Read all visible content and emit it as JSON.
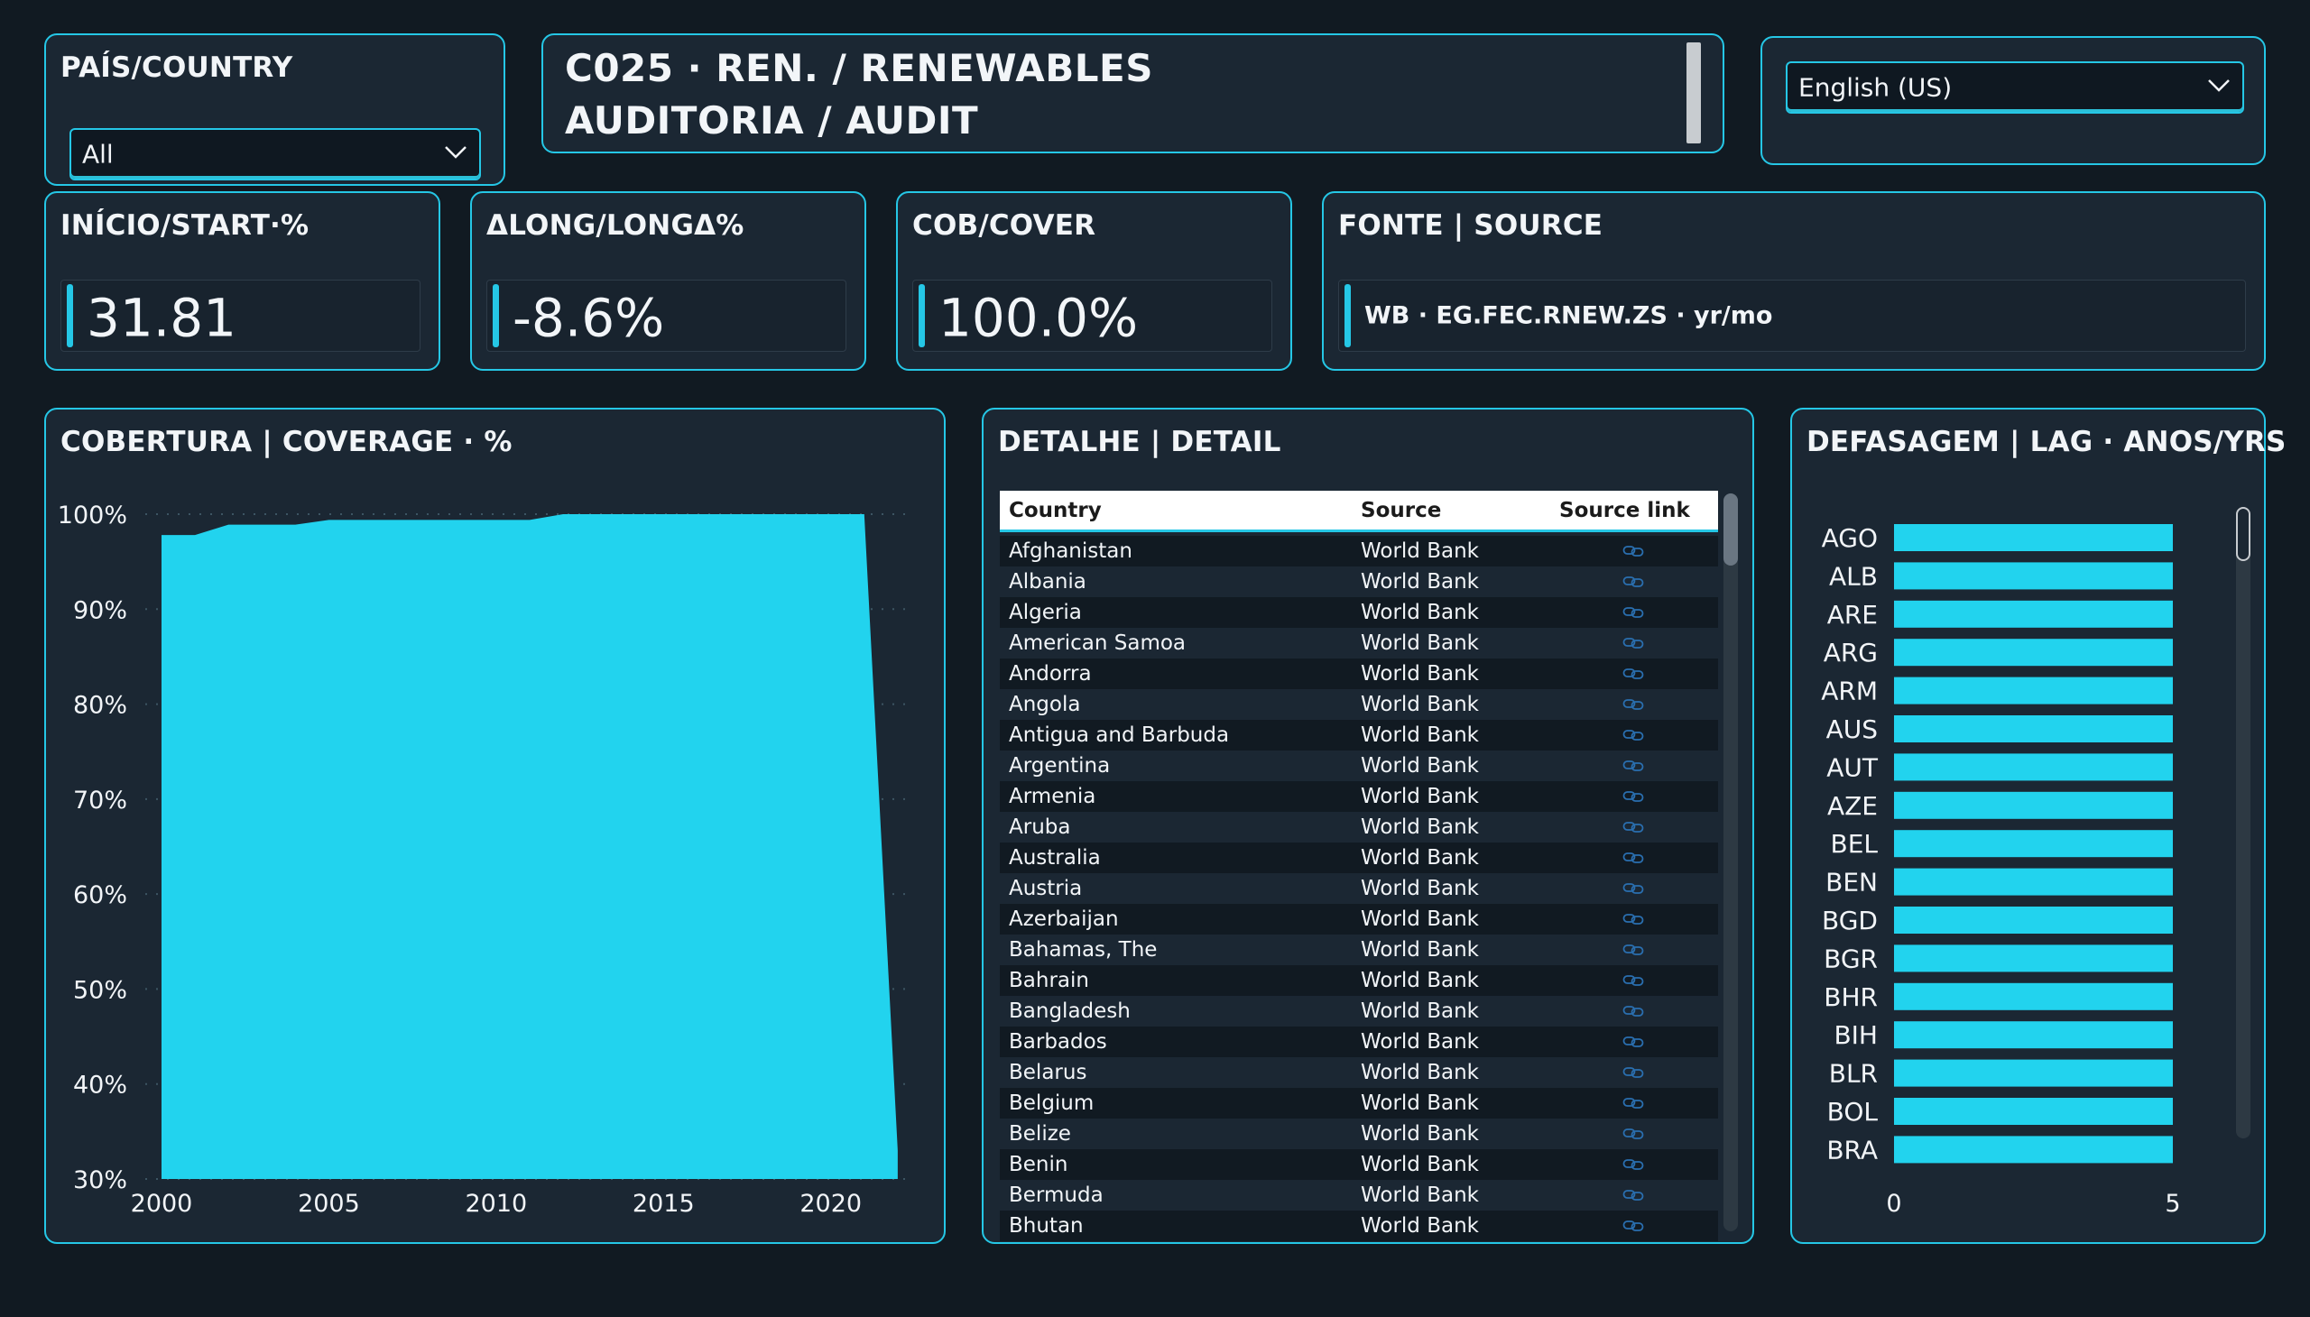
{
  "country_filter": {
    "title": "PAÍS/COUNTRY",
    "selected": "All",
    "icon": "chevron-down-icon"
  },
  "header": {
    "line1": "C025 · REN. / RENEWABLES",
    "line2": "AUDITORIA / AUDIT"
  },
  "language": {
    "selected": "English (US)",
    "icon": "chevron-down-icon"
  },
  "kpis": {
    "start": {
      "label": "INÍCIO/START·%",
      "value": "31.81"
    },
    "delta": {
      "label": "ΔLONG/LONGΔ%",
      "value": "-8.6%"
    },
    "cover": {
      "label": "COB/COVER",
      "value": "100.0%"
    },
    "source": {
      "label": "FONTE | SOURCE",
      "value": "WB · EG.FEC.RNEW.ZS · yr/mo"
    }
  },
  "colors": {
    "accent": "#25c7e6",
    "background": "#111a22",
    "card": "#1b2733"
  },
  "coverage_chart": {
    "title": "COBERTURA | COVERAGE · %",
    "y_ticks": [
      "100%",
      "90%",
      "80%",
      "70%",
      "60%",
      "50%",
      "40%",
      "30%"
    ],
    "x_ticks": [
      "2000",
      "2005",
      "2010",
      "2015",
      "2020"
    ]
  },
  "detail": {
    "title": "DETALHE | DETAIL",
    "columns": [
      "Country",
      "Source",
      "Source link"
    ],
    "link_icon": "link-icon",
    "rows": [
      [
        "Afghanistan",
        "World Bank"
      ],
      [
        "Albania",
        "World Bank"
      ],
      [
        "Algeria",
        "World Bank"
      ],
      [
        "American Samoa",
        "World Bank"
      ],
      [
        "Andorra",
        "World Bank"
      ],
      [
        "Angola",
        "World Bank"
      ],
      [
        "Antigua and Barbuda",
        "World Bank"
      ],
      [
        "Argentina",
        "World Bank"
      ],
      [
        "Armenia",
        "World Bank"
      ],
      [
        "Aruba",
        "World Bank"
      ],
      [
        "Australia",
        "World Bank"
      ],
      [
        "Austria",
        "World Bank"
      ],
      [
        "Azerbaijan",
        "World Bank"
      ],
      [
        "Bahamas, The",
        "World Bank"
      ],
      [
        "Bahrain",
        "World Bank"
      ],
      [
        "Bangladesh",
        "World Bank"
      ],
      [
        "Barbados",
        "World Bank"
      ],
      [
        "Belarus",
        "World Bank"
      ],
      [
        "Belgium",
        "World Bank"
      ],
      [
        "Belize",
        "World Bank"
      ],
      [
        "Benin",
        "World Bank"
      ],
      [
        "Bermuda",
        "World Bank"
      ],
      [
        "Bhutan",
        "World Bank"
      ]
    ]
  },
  "lag_chart": {
    "title": "DEFASAGEM | LAG · ANOS/YRS",
    "x_ticks": [
      "0",
      "5"
    ]
  },
  "chart_data": [
    {
      "type": "area",
      "title": "COBERTURA | COVERAGE · %",
      "xlabel": "",
      "ylabel": "",
      "x": [
        2000,
        2001,
        2002,
        2003,
        2004,
        2005,
        2006,
        2007,
        2008,
        2009,
        2010,
        2011,
        2012,
        2013,
        2014,
        2015,
        2016,
        2017,
        2018,
        2019,
        2020,
        2021,
        2022
      ],
      "series": [
        {
          "values": [
            97.8,
            97.8,
            98.9,
            98.9,
            98.9,
            99.4,
            99.4,
            99.4,
            99.4,
            99.4,
            99.4,
            99.4,
            100,
            100,
            100,
            100,
            100,
            100,
            100,
            100,
            100,
            100,
            33
          ]
        }
      ],
      "ylim": [
        30,
        100
      ],
      "xlim": [
        2000,
        2022.3
      ],
      "grid": true
    },
    {
      "type": "bar",
      "title": "DEFASAGEM | LAG · ANOS/YRS",
      "orientation": "horizontal",
      "categories": [
        "AGO",
        "ALB",
        "ARE",
        "ARG",
        "ARM",
        "AUS",
        "AUT",
        "AZE",
        "BEL",
        "BEN",
        "BGD",
        "BGR",
        "BHR",
        "BIH",
        "BLR",
        "BOL",
        "BRA"
      ],
      "values": [
        5,
        5,
        5,
        5,
        5,
        5,
        5,
        5,
        5,
        5,
        5,
        5,
        5,
        5,
        5,
        5,
        5
      ],
      "xlim": [
        0,
        5
      ],
      "xlabel": "",
      "ylabel": ""
    }
  ]
}
